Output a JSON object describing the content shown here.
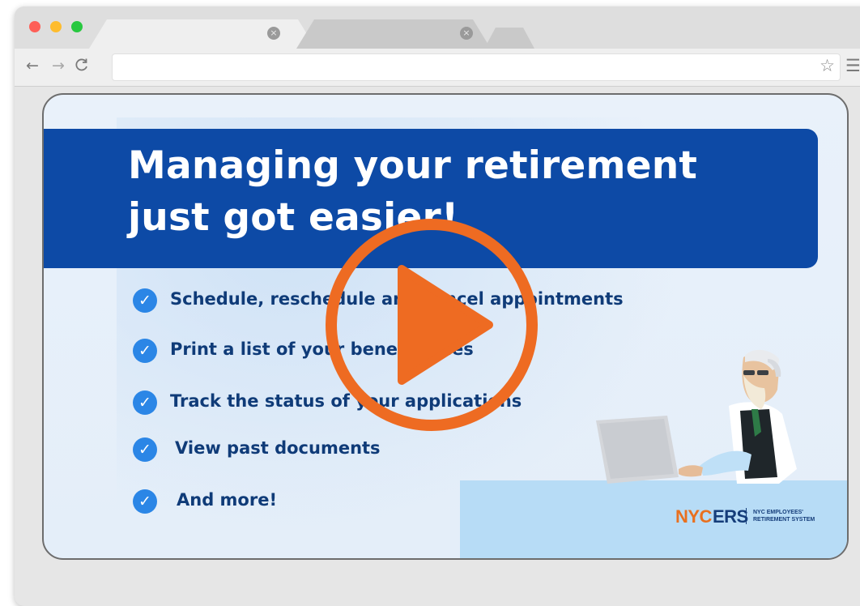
{
  "browser": {
    "tabs": [
      {
        "close_glyph": "×"
      },
      {
        "close_glyph": "×"
      }
    ],
    "nav": {
      "back": "←",
      "forward": "→",
      "reload": "C"
    },
    "url": "",
    "bookmark_icon": "star-icon",
    "menu_icon": "hamburger-menu-icon",
    "colors": {
      "close": "#fe5f57",
      "minimize": "#febc2e",
      "maximize": "#28c840"
    }
  },
  "video": {
    "title_line1": "Managing your retirement",
    "title_line2": "just got easier!",
    "bullets": [
      "Schedule, reschedule and cancel appointments",
      "Print a list of your beneficiaries",
      "Track the status of your applications",
      "View past documents",
      "And more!"
    ],
    "check_glyph": "✓",
    "logo": {
      "nyc": "NYC",
      "ers": "ERS",
      "line1": "NYC EMPLOYEES'",
      "line2": "RETIREMENT SYSTEM"
    },
    "play_button_color": "#ee6b22",
    "banner_color": "#0d4aa6"
  }
}
